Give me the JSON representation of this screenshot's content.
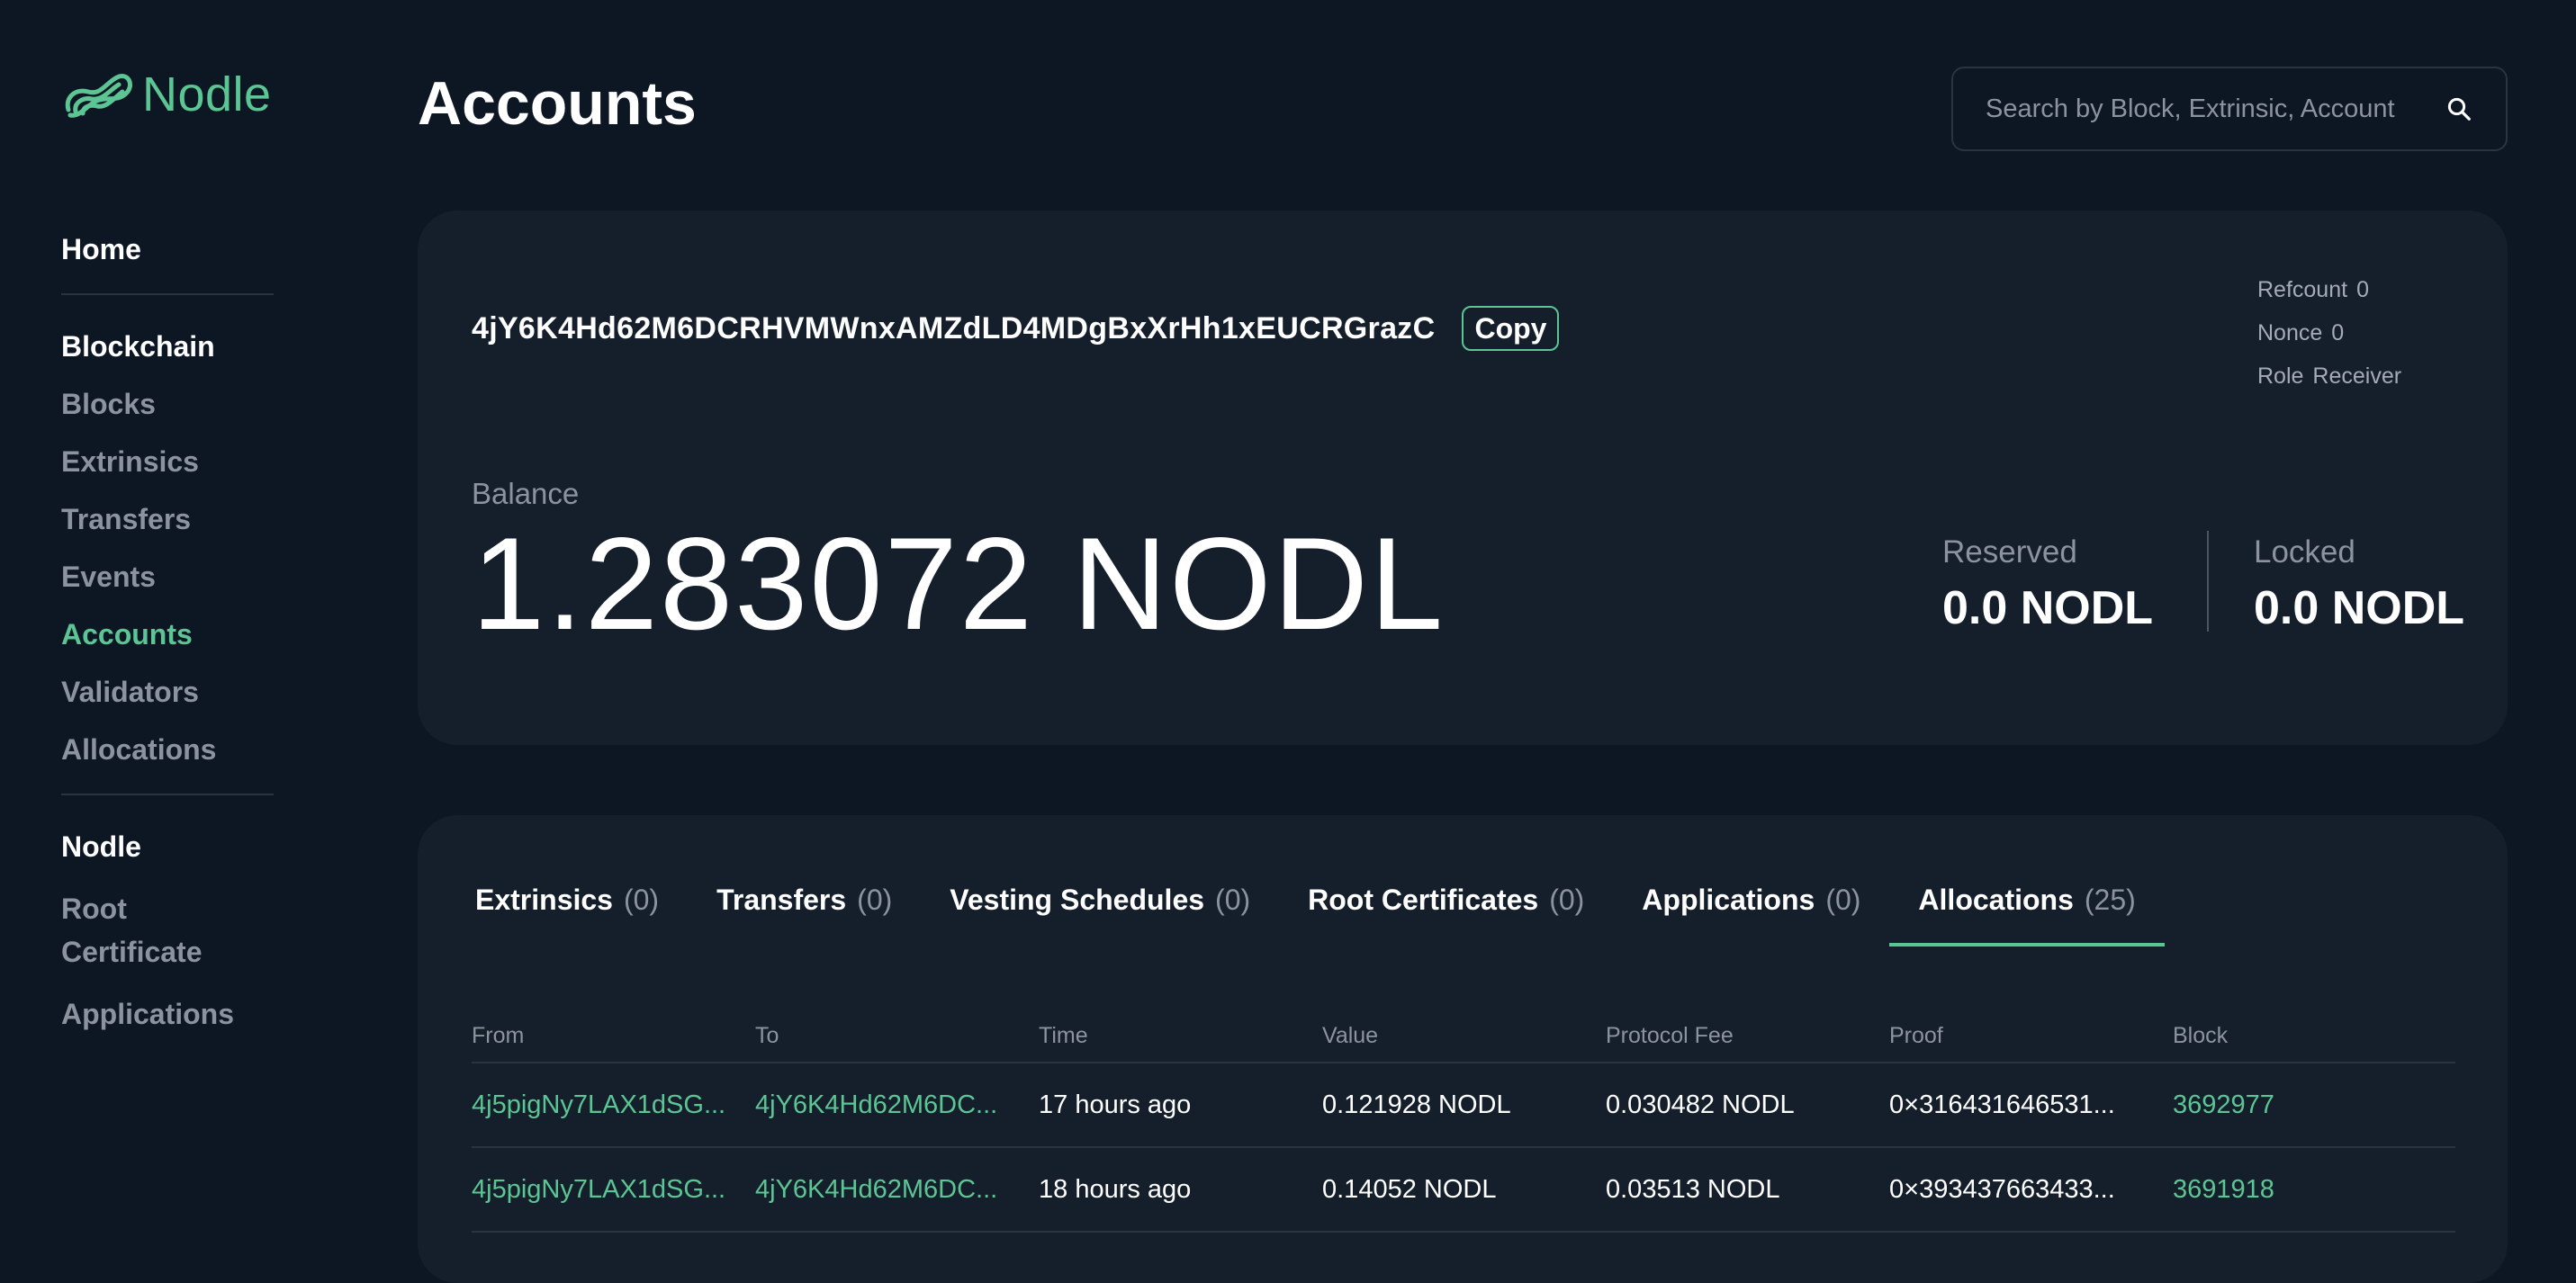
{
  "brand": {
    "name": "Nodle",
    "accent": "#5cc594"
  },
  "nav": {
    "home": "Home",
    "blockchain_heading": "Blockchain",
    "blockchain_items": [
      {
        "label": "Blocks"
      },
      {
        "label": "Extrinsics"
      },
      {
        "label": "Transfers"
      },
      {
        "label": "Events"
      },
      {
        "label": "Accounts",
        "active": true
      },
      {
        "label": "Validators"
      },
      {
        "label": "Allocations"
      }
    ],
    "nodle_heading": "Nodle",
    "nodle_items": [
      {
        "label": "Root Certificate"
      },
      {
        "label": "Applications"
      }
    ]
  },
  "header": {
    "title": "Accounts",
    "search_placeholder": "Search by Block, Extrinsic, Account",
    "search_icon": "search-icon"
  },
  "account": {
    "address": "4jY6K4Hd62M6DCRHVMWnxAMZdLD4MDgBxXrHh1xEUCRGrazC",
    "copy_label": "Copy",
    "refcount_label": "Refcount",
    "refcount": "0",
    "nonce_label": "Nonce",
    "nonce": "0",
    "role_label": "Role",
    "role": "Receiver",
    "balance_label": "Balance",
    "balance": "1.283072 NODL",
    "reserved_label": "Reserved",
    "reserved": "0.0 NODL",
    "locked_label": "Locked",
    "locked": "0.0 NODL"
  },
  "tabs": [
    {
      "label": "Extrinsics",
      "count": "(0)"
    },
    {
      "label": "Transfers",
      "count": "(0)"
    },
    {
      "label": "Vesting Schedules",
      "count": "(0)"
    },
    {
      "label": "Root Certificates",
      "count": "(0)"
    },
    {
      "label": "Applications",
      "count": "(0)"
    },
    {
      "label": "Allocations",
      "count": "(25)",
      "active": true
    }
  ],
  "table": {
    "columns": [
      "From",
      "To",
      "Time",
      "Value",
      "Protocol Fee",
      "Proof",
      "Block"
    ],
    "rows": [
      [
        "4j5pigNy7LAX1dSG...",
        "4jY6K4Hd62M6DC...",
        "17 hours ago",
        "0.121928 NODL",
        "0.030482 NODL",
        "0×316431646531...",
        "3692977"
      ],
      [
        "4j5pigNy7LAX1dSG...",
        "4jY6K4Hd62M6DC...",
        "18 hours ago",
        "0.14052 NODL",
        "0.03513 NODL",
        "0×393437663433...",
        "3691918"
      ]
    ]
  }
}
